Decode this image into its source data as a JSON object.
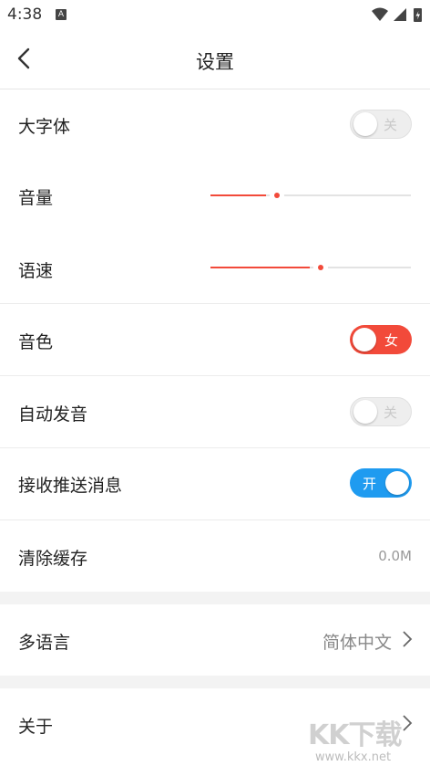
{
  "status": {
    "time": "4:38",
    "indicator": "A"
  },
  "header": {
    "title": "设置"
  },
  "settings": {
    "large_font": {
      "label": "大字体",
      "toggle_text": "关",
      "state": "off"
    },
    "volume": {
      "label": "音量",
      "level": 0.33
    },
    "speech_rate": {
      "label": "语速",
      "level": 0.55
    },
    "voice": {
      "label": "音色",
      "toggle_text": "女",
      "state": "female"
    },
    "auto_pronounce": {
      "label": "自动发音",
      "toggle_text": "关",
      "state": "off"
    },
    "push": {
      "label": "接收推送消息",
      "toggle_text": "开",
      "state": "on"
    },
    "cache": {
      "label": "清除缓存",
      "value": "0.0M"
    },
    "language": {
      "label": "多语言",
      "value": "简体中文"
    },
    "about": {
      "label": "关于"
    }
  },
  "watermark": {
    "text": "KK下载",
    "url": "www.kkx.net"
  },
  "colors": {
    "accent_red": "#f24a3a",
    "accent_blue": "#1f9bf0"
  }
}
